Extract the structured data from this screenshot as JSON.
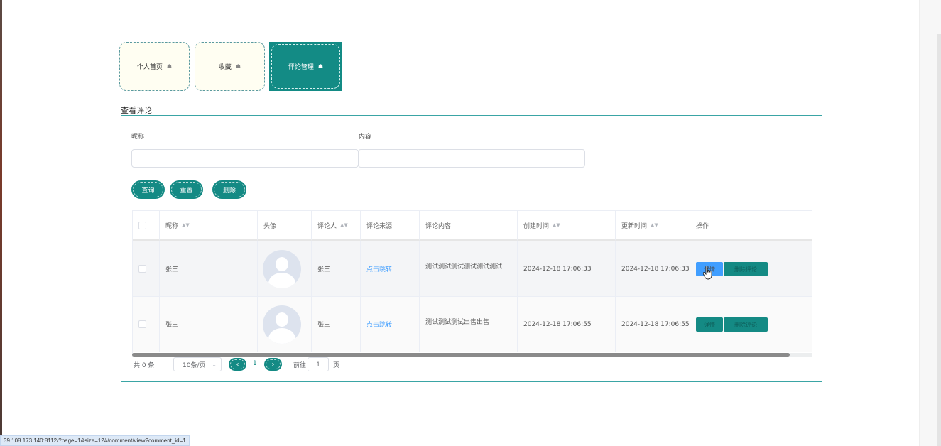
{
  "tabs": [
    {
      "label": "个人首页",
      "icon": "home-icon"
    },
    {
      "label": "收藏",
      "icon": "home-icon"
    },
    {
      "label": "评论管理",
      "icon": "home-icon"
    }
  ],
  "section_title": "查看评论",
  "search": {
    "nickname_label": "昵称",
    "nickname_value": "",
    "content_label": "内容",
    "content_value": ""
  },
  "buttons": {
    "query": "查询",
    "reset": "重置",
    "delete": "删除"
  },
  "table": {
    "columns": [
      "昵称",
      "头像",
      "评论人",
      "评论来源",
      "评论内容",
      "创建时间",
      "更新时间",
      "操作"
    ],
    "rows": [
      {
        "nickname": "张三",
        "commenter": "张三",
        "source": "点击跳转",
        "content": "测试测试测试测试测试测试",
        "created": "2024-12-18 17:06:33",
        "updated": "2024-12-18 17:06:33"
      },
      {
        "nickname": "张三",
        "commenter": "张三",
        "source": "点击跳转",
        "content": "测试测试测试出售出售",
        "created": "2024-12-18 17:06:55",
        "updated": "2024-12-18 17:06:55"
      }
    ],
    "actions": {
      "view": "详情",
      "delete": "删除评论"
    }
  },
  "pagination": {
    "total": "共 0 条",
    "page_size": "10条/页",
    "current_page": "1",
    "goto_label": "前往",
    "goto_value": "1",
    "page_unit": "页"
  },
  "status_url": "39.108.173.140:8112/?page=1&size=12#/comment/view?comment_id=1",
  "colors": {
    "primary": "#148a84",
    "link": "#409eff",
    "border": "#3aa5a5"
  }
}
